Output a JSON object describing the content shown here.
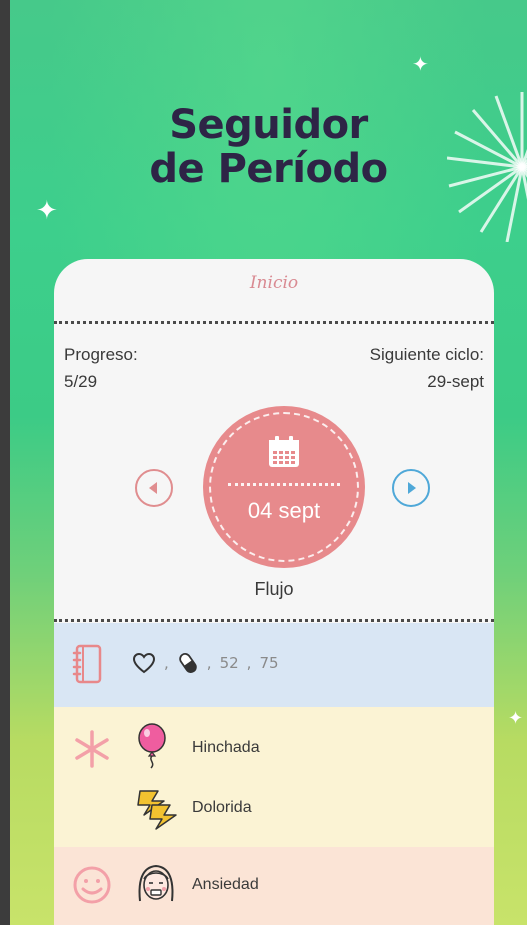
{
  "header": {
    "title_line1": "Seguidor",
    "title_line2": "de Período"
  },
  "card": {
    "title": "Inicio",
    "progress": {
      "label": "Progreso:",
      "value": "5/29"
    },
    "next_cycle": {
      "label": "Siguiente ciclo:",
      "value": "29-sept"
    },
    "current_date": "04 sept",
    "flow_label": "Flujo",
    "log_row": {
      "icons": [
        "heart-icon",
        "pill-icon"
      ],
      "separator": ",",
      "values": [
        "52",
        "75"
      ]
    },
    "symptoms": [
      {
        "icon": "balloon-icon",
        "label": "Hinchada"
      },
      {
        "icon": "lightning-icon",
        "label": "Dolorida"
      }
    ],
    "moods": [
      {
        "icon": "anxious-face-icon",
        "label": "Ansiedad"
      }
    ]
  },
  "colors": {
    "accent_pink": "#e78a8c",
    "accent_blue": "#4fa8d8",
    "title_color": "#2e2446",
    "row_blue": "#d9e6f4",
    "row_yellow": "#fbf3d4",
    "row_pink": "#fbe4d6"
  }
}
